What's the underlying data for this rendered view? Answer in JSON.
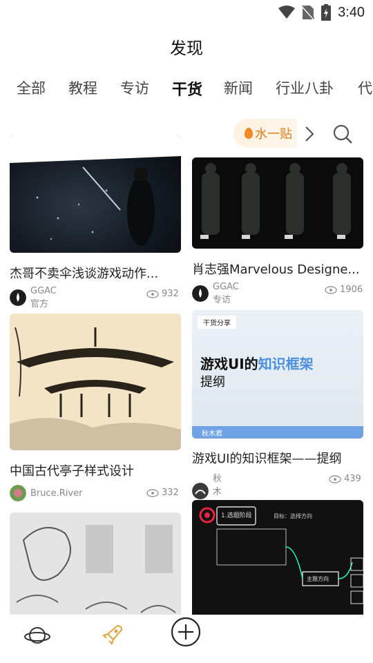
{
  "status": {
    "time": "3:40"
  },
  "header": {
    "title": "发现"
  },
  "tabs": [
    {
      "label": "全部"
    },
    {
      "label": "教程"
    },
    {
      "label": "专访"
    },
    {
      "label": "干货",
      "active": true
    },
    {
      "label": "新闻"
    },
    {
      "label": "行业八卦"
    },
    {
      "label": "代"
    }
  ],
  "promo": {
    "label": "水一贴"
  },
  "cards": [
    {
      "title": "杰哥不卖伞浅谈游戏动作...",
      "author": "GGAC官方",
      "views": "932"
    },
    {
      "title": "肖志强Marvelous Designe...",
      "author": "GGAC专访",
      "views": "1906"
    },
    {
      "title": "中国古代亭子样式设计",
      "author": "Bruce.River",
      "views": "332"
    },
    {
      "title": "游戏UI的知识框架——提纲",
      "author": "秋木君",
      "views": "439",
      "thumb": {
        "tag": "干货分享",
        "line1_a": "游戏UI的",
        "line1_b": "知识框架",
        "line2": "提纲",
        "footer": "秋木君"
      }
    },
    {
      "title": "",
      "author": "",
      "views": ""
    },
    {
      "title": "",
      "author": "",
      "views": "",
      "thumb": {
        "badge": "1.选题阶段",
        "top": "目标：选择方向",
        "box": "主题方向"
      }
    }
  ],
  "colors": {
    "accent": "#e47a12",
    "ui_blue": "#4b8ee0"
  },
  "icons": [
    "wifi-icon",
    "no-sim-icon",
    "battery-icon",
    "flame-icon",
    "chevron-right-icon",
    "search-icon",
    "eye-icon",
    "planet-icon",
    "rocket-icon",
    "plus-icon"
  ]
}
